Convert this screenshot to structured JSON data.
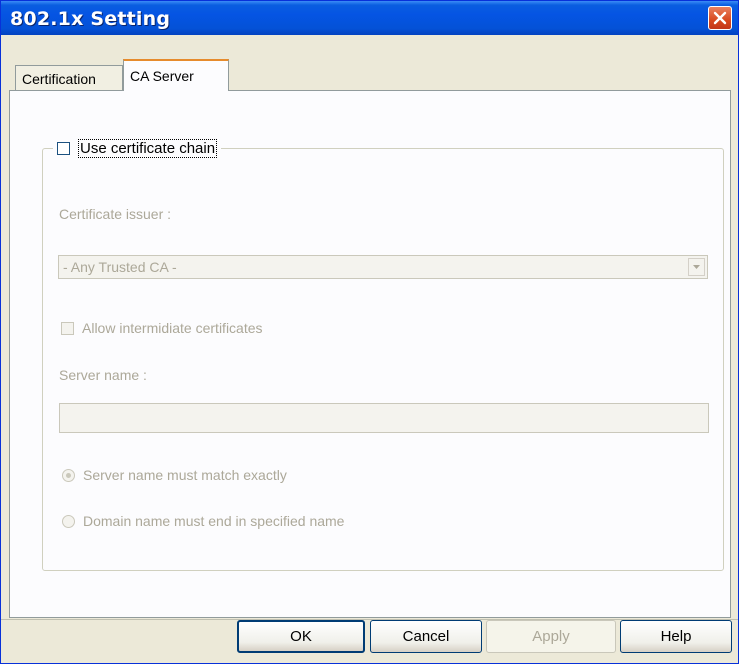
{
  "window": {
    "title": "802.1x Setting",
    "close_icon": "close-icon"
  },
  "tabs": [
    {
      "label": "Certification",
      "selected": false
    },
    {
      "label": "CA Server",
      "selected": true
    }
  ],
  "ca_server": {
    "use_chain": {
      "label": "Use certificate chain",
      "checked": false
    },
    "issuer_label": "Certificate issuer :",
    "issuer_value": "- Any Trusted CA -",
    "allow_intermediate": {
      "label": "Allow intermidiate certificates",
      "checked": false
    },
    "server_name_label": "Server name :",
    "server_name_value": "",
    "match_exact": {
      "label": "Server name must match exactly",
      "checked": true
    },
    "match_domain": {
      "label": "Domain name must end in specified name",
      "checked": false
    }
  },
  "buttons": {
    "ok": "OK",
    "cancel": "Cancel",
    "apply": "Apply",
    "help": "Help"
  }
}
